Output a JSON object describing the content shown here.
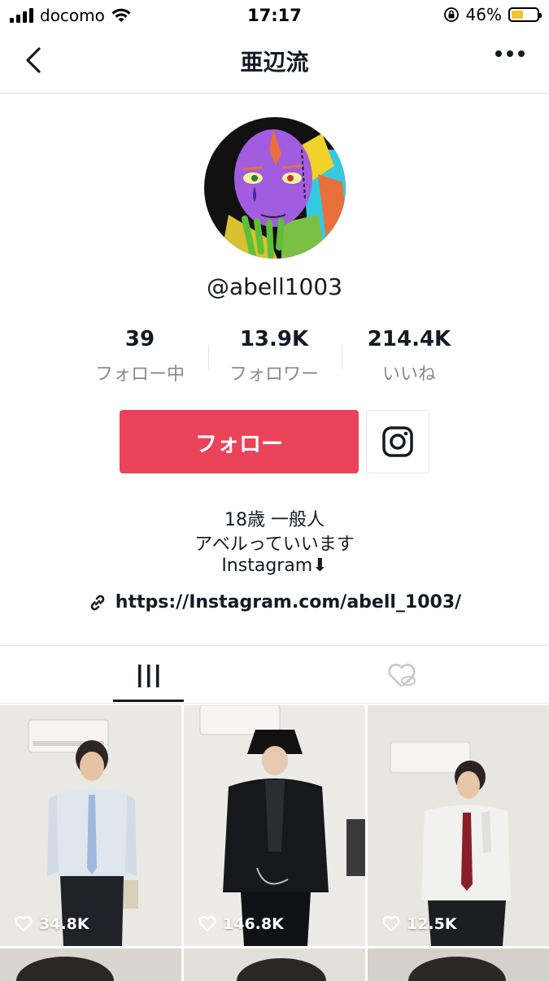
{
  "status": {
    "carrier": "docomo",
    "time": "17:17",
    "battery": "46%",
    "battery_level": 0.46
  },
  "nav": {
    "title": "亜辺流",
    "back_icon": "chevron-left-icon",
    "more_icon": "more-dots-icon"
  },
  "profile": {
    "username": "@abell1003",
    "stats": [
      {
        "value": "39",
        "label": "フォロー中"
      },
      {
        "value": "13.9K",
        "label": "フォロワー"
      },
      {
        "value": "214.4K",
        "label": "いいね"
      }
    ],
    "follow_label": "フォロー",
    "bio_lines": [
      "18歳 一般人",
      "アベルっていいます",
      "Instagram⬇︎"
    ],
    "link": "https://Instagram.com/abell_1003/"
  },
  "tabs": {
    "active": "videos"
  },
  "videos": [
    {
      "likes": "34.8K"
    },
    {
      "likes": "146.8K"
    },
    {
      "likes": "12.5K"
    }
  ],
  "colors": {
    "accent": "#ea4359",
    "text": "#161823",
    "muted": "#8a8b91"
  }
}
